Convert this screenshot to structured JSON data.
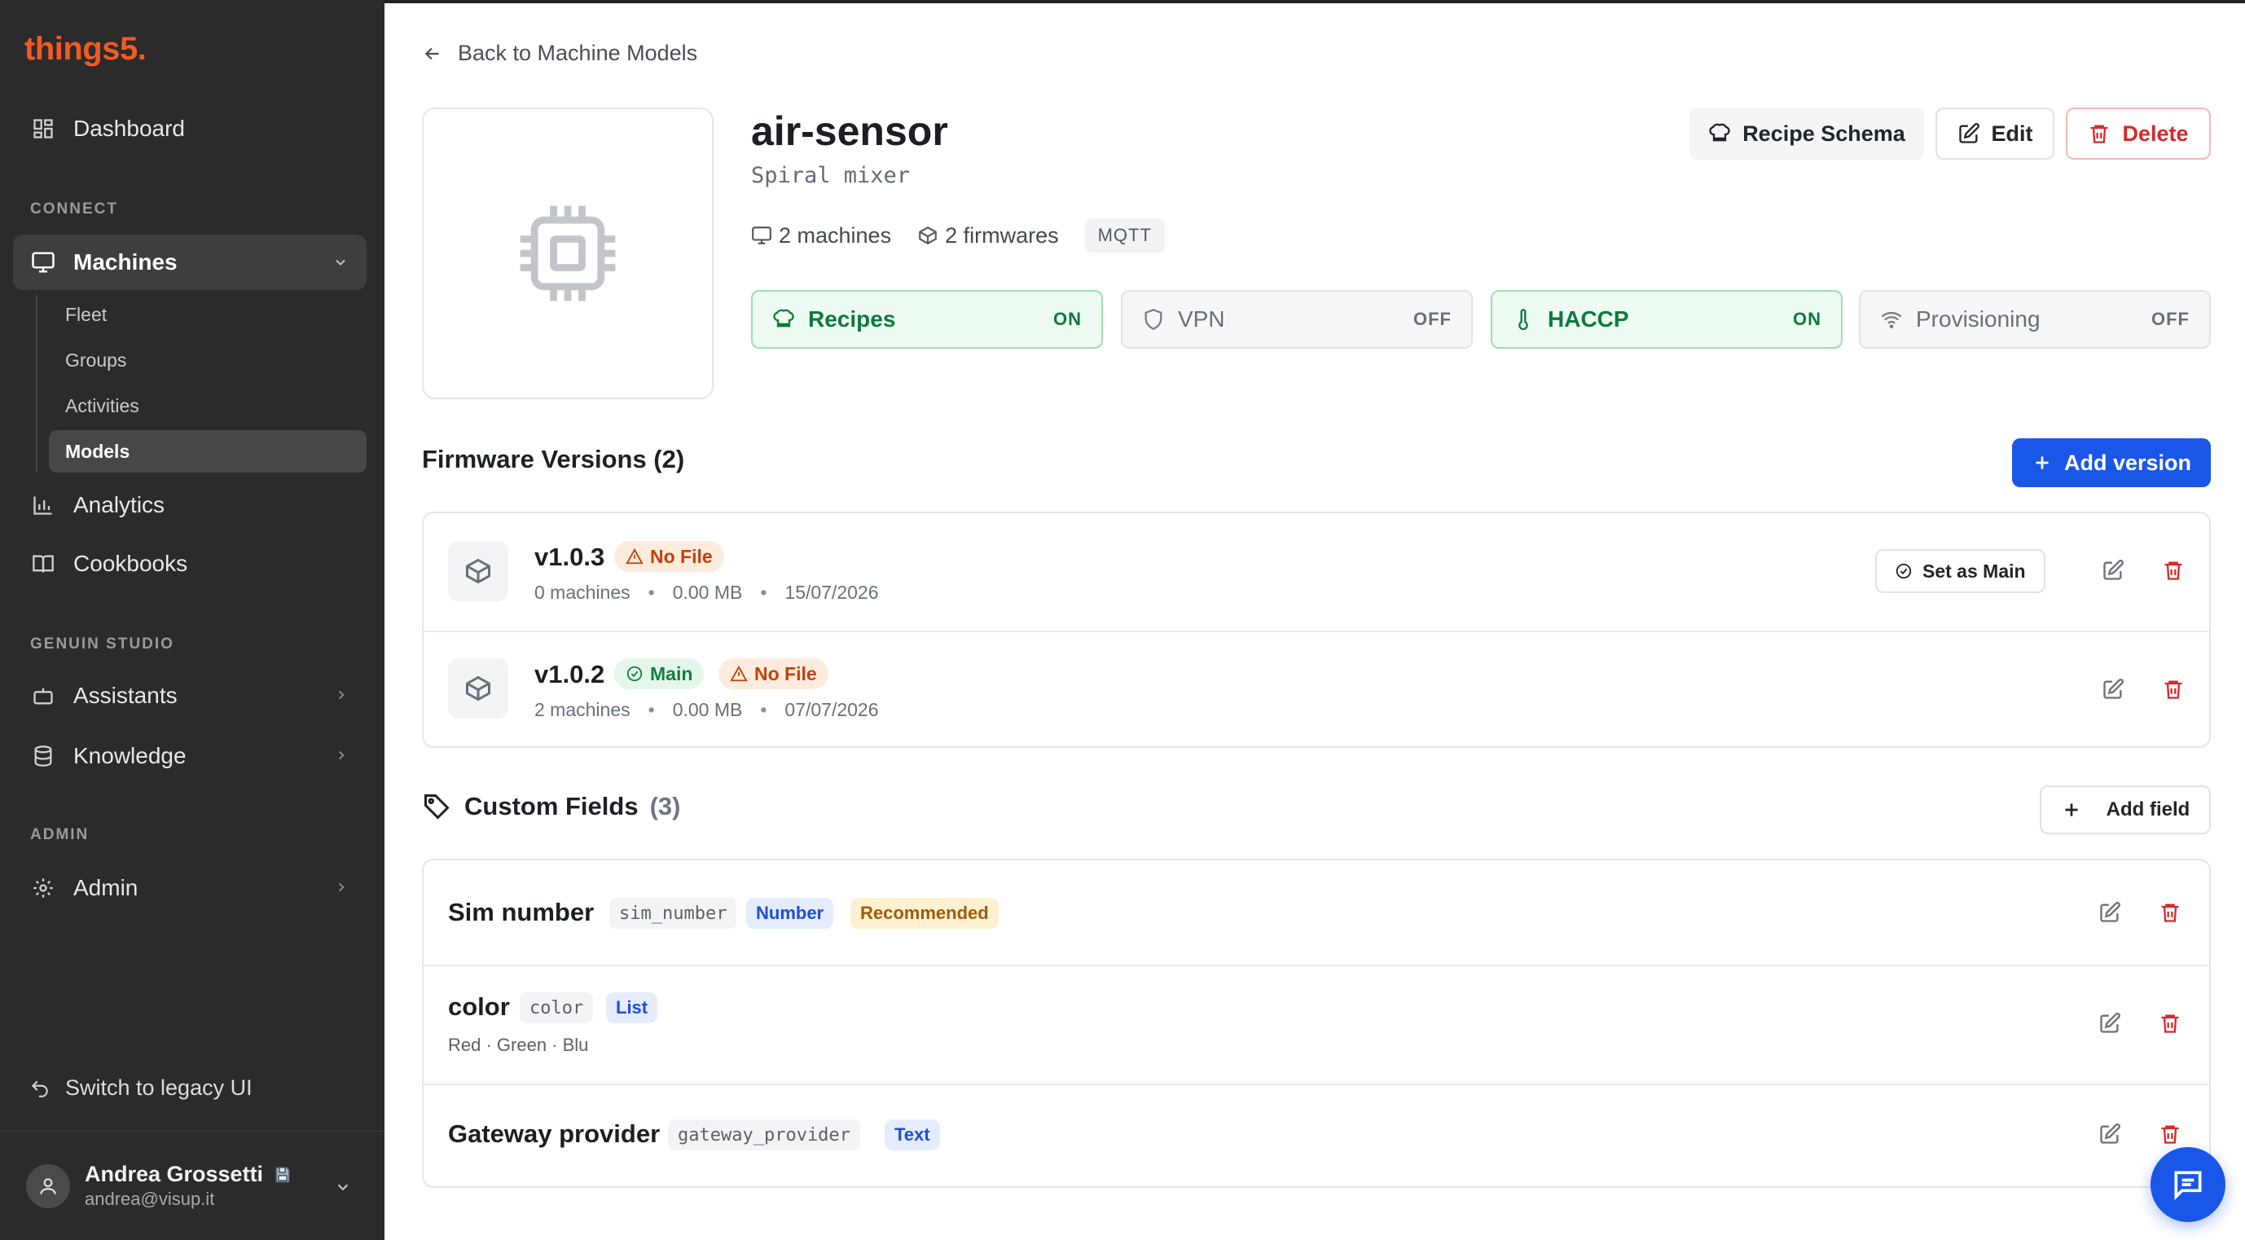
{
  "app": {
    "logo": "things5."
  },
  "sidebar": {
    "dashboard": "Dashboard",
    "sections": {
      "connect": "CONNECT",
      "studio": "GENUIN STUDIO",
      "admin": "ADMIN"
    },
    "machines": "Machines",
    "sub": [
      "Fleet",
      "Groups",
      "Activities",
      "Models"
    ],
    "analytics": "Analytics",
    "cookbooks": "Cookbooks",
    "assistants": "Assistants",
    "knowledge": "Knowledge",
    "admin": "Admin",
    "legacy": "Switch to legacy UI",
    "user": {
      "name": "Andrea Grossetti",
      "email": "andrea@visup.it"
    }
  },
  "header": {
    "back": "Back to Machine Models",
    "title": "air-sensor",
    "subtitle": "Spiral mixer",
    "machines": "2 machines",
    "firmwares": "2 firmwares",
    "protocol": "MQTT",
    "actions": {
      "recipe_schema": "Recipe Schema",
      "edit": "Edit",
      "delete": "Delete"
    }
  },
  "features": [
    {
      "label": "Recipes",
      "state": "ON",
      "icon": "chef-hat-icon"
    },
    {
      "label": "VPN",
      "state": "OFF",
      "icon": "shield-icon"
    },
    {
      "label": "HACCP",
      "state": "ON",
      "icon": "thermometer-icon"
    },
    {
      "label": "Provisioning",
      "state": "OFF",
      "icon": "wifi-icon"
    }
  ],
  "firmware": {
    "title": "Firmware Versions (2)",
    "add_label": "Add version",
    "versions": [
      {
        "version": "v1.0.3",
        "tags": [
          "No File"
        ],
        "machines": "0 machines",
        "size": "0.00 MB",
        "date": "15/07/2026",
        "set_main": "Set as Main"
      },
      {
        "version": "v1.0.2",
        "tags": [
          "Main",
          "No File"
        ],
        "machines": "2 machines",
        "size": "0.00 MB",
        "date": "07/07/2026"
      }
    ]
  },
  "custom_fields": {
    "title": "Custom Fields",
    "count": "(3)",
    "add_label": "Add field",
    "fields": [
      {
        "name": "Sim number",
        "key": "sim_number",
        "type": "Number",
        "badge": "Recommended"
      },
      {
        "name": "color",
        "key": "color",
        "type": "List",
        "options": "Red · Green · Blu"
      },
      {
        "name": "Gateway provider",
        "key": "gateway_provider",
        "type": "Text"
      }
    ]
  },
  "colors": {
    "brand": "#f15a24",
    "primary": "#1a56e8",
    "danger": "#d42a2a",
    "success": "#15803d",
    "warning": "#c2410c"
  }
}
